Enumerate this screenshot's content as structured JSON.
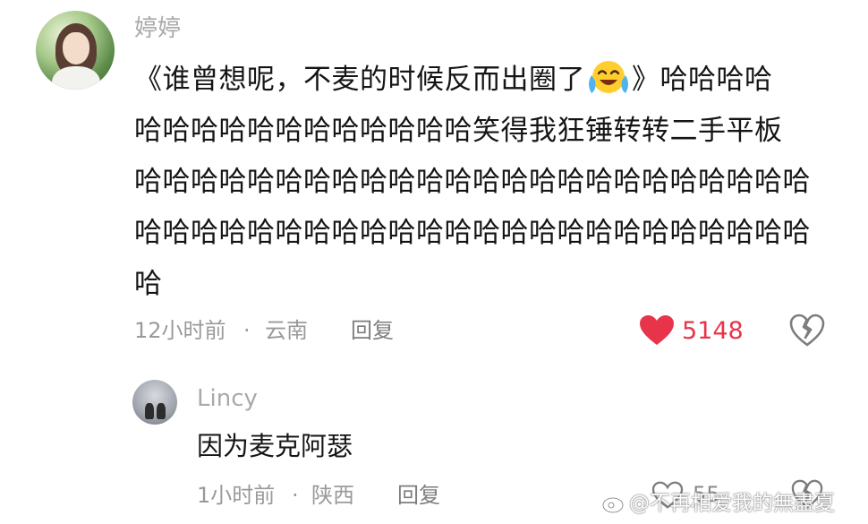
{
  "comment": {
    "username": "婷婷",
    "text_line1": "《谁曾想呢，不麦的时候反而出圈了",
    "text_line1_tail": "》哈哈哈哈",
    "text_line2": "哈哈哈哈哈哈哈哈哈哈哈哈笑得我狂锤转转二手平板",
    "text_line3": "哈哈哈哈哈哈哈哈哈哈哈哈哈哈哈哈哈哈哈哈哈哈哈哈",
    "text_line4": "哈哈哈哈哈哈哈哈哈哈哈哈哈哈哈哈哈哈哈哈哈哈哈哈",
    "text_line5": "哈",
    "time": "12小时前",
    "separator": "·",
    "location": "云南",
    "reply_label": "回复",
    "like_count": "5148",
    "emoji": "crying-laughing-emoji"
  },
  "reply": {
    "username": "Lincy",
    "text": "因为麦克阿瑟",
    "time": "1小时前",
    "separator": "·",
    "location": "陕西",
    "reply_label": "回复",
    "like_count": "55"
  },
  "watermark": {
    "text": "@不再相爱我的無盡夏"
  },
  "colors": {
    "heart_red": "#e8344b",
    "meta_gray": "#9a9a9a",
    "text_black": "#151515"
  }
}
